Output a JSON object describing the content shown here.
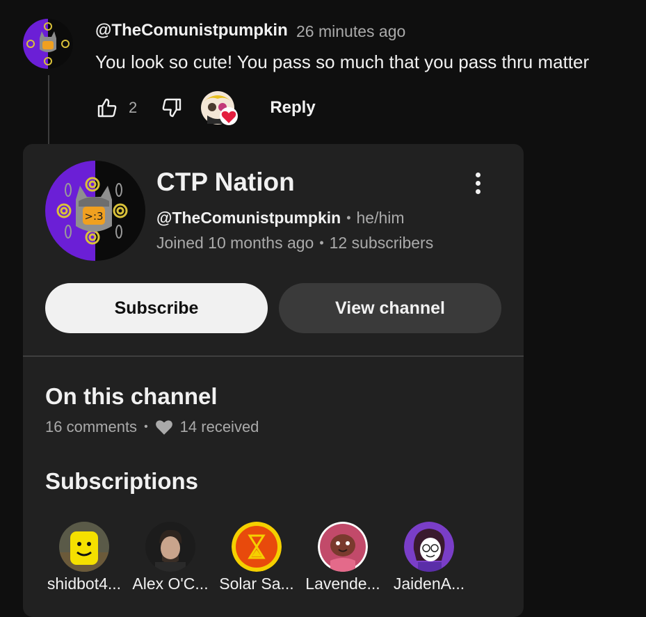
{
  "comment": {
    "author": "@TheComunistpumpkin",
    "time": "26 minutes ago",
    "text": "You look so cute! You pass so much that you pass thru matter",
    "like_count": "2",
    "reply_label": "Reply",
    "icons": [
      "like-icon",
      "dislike-icon",
      "creator-heart-icon"
    ]
  },
  "channel_card": {
    "name": "CTP Nation",
    "handle": "@TheComunistpumpkin",
    "pronouns": "he/him",
    "joined": "Joined 10 months ago",
    "subscribers": "12 subscribers",
    "subscribe_label": "Subscribe",
    "view_channel_label": "View channel",
    "on_this_channel": {
      "title": "On this channel",
      "comments": "16 comments",
      "received": "14 received"
    },
    "subscriptions": {
      "title": "Subscriptions",
      "items": [
        {
          "name": "shidbot4..."
        },
        {
          "name": "Alex O'C..."
        },
        {
          "name": "Solar Sa..."
        },
        {
          "name": "Lavende..."
        },
        {
          "name": "JaidenA..."
        }
      ]
    }
  },
  "colors": {
    "background": "#0f0f0f",
    "card": "#212121",
    "text_primary": "#f1f1f1",
    "text_secondary": "#aaaaaa",
    "avatar_purple": "#6b1fd6",
    "heart_red": "#e41e3f"
  }
}
